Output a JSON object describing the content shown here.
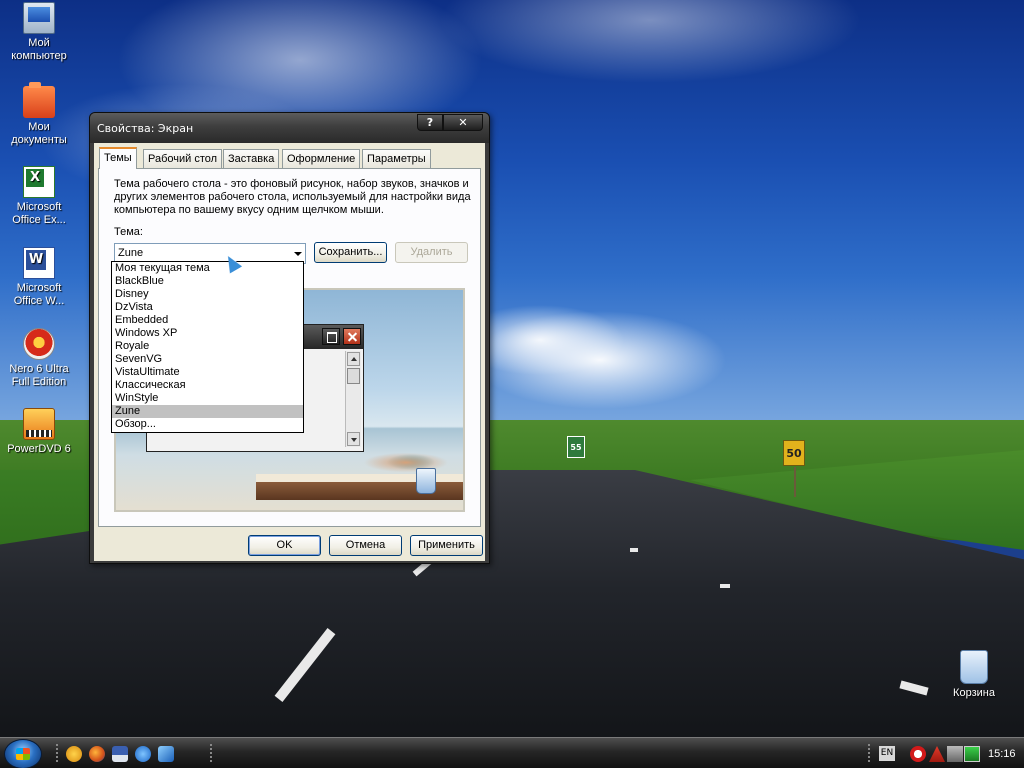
{
  "desktop": {
    "icons": [
      {
        "label": "Мой компьютер"
      },
      {
        "label": "Мои документы"
      },
      {
        "label": "Microsoft Office Ex..."
      },
      {
        "label": "Microsoft Office W..."
      },
      {
        "label": "Nero 6 Ultra Full Edition"
      },
      {
        "label": "PowerDVD 6"
      }
    ],
    "recycle_bin": {
      "label": "Корзина"
    },
    "road_sign_speed": "50",
    "road_sign_exit": "55"
  },
  "dialog": {
    "title": "Свойства: Экран",
    "help_label": "?",
    "close_label": "✕",
    "tabs": [
      {
        "label": "Темы",
        "active": true
      },
      {
        "label": "Рабочий стол"
      },
      {
        "label": "Заставка"
      },
      {
        "label": "Оформление"
      },
      {
        "label": "Параметры"
      }
    ],
    "description": "Тема рабочего стола - это фоновый рисунок, набор звуков, значков и других элементов рабочего стола, используемый для настройки вида компьютера по вашему вкусу одним щелчком мыши.",
    "theme_label": "Тема:",
    "theme_value": "Zune",
    "save_label": "Сохранить...",
    "delete_label": "Удалить",
    "theme_options": [
      "Моя текущая тема",
      "BlackBlue",
      "Disney",
      "DzVista",
      "Embedded",
      "Windows XP",
      "Royale",
      "SevenVG",
      "VistaUltimate",
      "Классическая",
      "WinStyle",
      "Zune",
      "Обзор..."
    ],
    "selected_option_index": 11,
    "ok_label": "OK",
    "cancel_label": "Отмена",
    "apply_label": "Применить"
  },
  "taskbar": {
    "tray_lang": "EN",
    "clock": "15:16"
  },
  "colors": {
    "title_bar": "#3e3e3e",
    "dialog_face": "#ece9d8",
    "tab_accent": "#e68b2c",
    "list_selection": "#c1c1c1"
  }
}
